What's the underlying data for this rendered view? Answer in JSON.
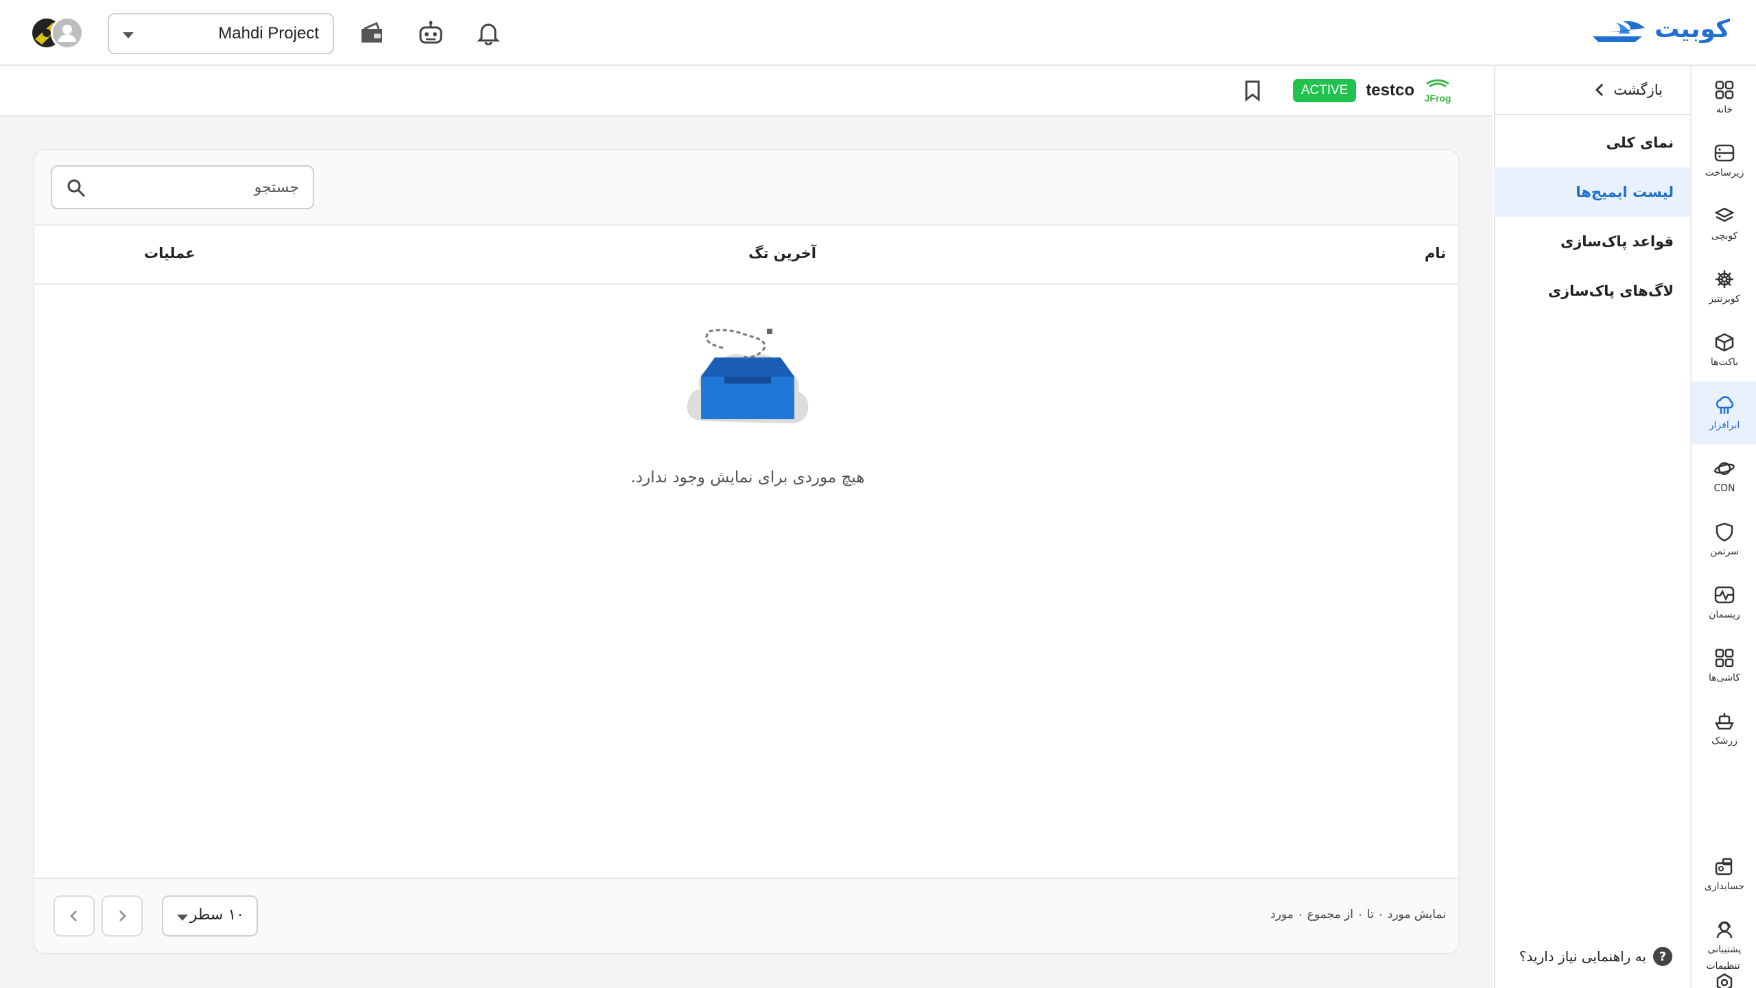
{
  "header": {
    "logo_text": "کوبیت",
    "project_select": "Mahdi Project",
    "icons": [
      "wallet-icon",
      "robot-icon",
      "bell-icon"
    ]
  },
  "rail": {
    "items": [
      {
        "label": "خانه",
        "icon": "grid-icon"
      },
      {
        "label": "زیرساخت",
        "icon": "server-icon"
      },
      {
        "label": "کوبچی",
        "icon": "layers-icon"
      },
      {
        "label": "کوبرنتیز",
        "icon": "helm-icon"
      },
      {
        "label": "باکت‌ها",
        "icon": "box-icon"
      },
      {
        "label": "ابرافزار",
        "icon": "cloud-icon",
        "active": true
      },
      {
        "label": "CDN",
        "icon": "planet-icon"
      },
      {
        "label": "سرتمن",
        "icon": "shield-icon"
      },
      {
        "label": "ریسمان",
        "icon": "pulse-icon"
      },
      {
        "label": "کاشی‌ها",
        "icon": "tiles-icon"
      },
      {
        "label": "زرشک",
        "icon": "ship-icon"
      },
      {
        "label": "حسابداری",
        "icon": "accounting-icon"
      },
      {
        "label": "پشتیبانی",
        "icon": "support-icon"
      },
      {
        "label": "تنظیمات",
        "icon": "settings-icon"
      }
    ]
  },
  "sidenav": {
    "back": "بازگشت",
    "items": [
      "نمای کلی",
      "لیست ایمیج‌ها",
      "قواعد پاک‌سازی",
      "لاگ‌های پاک‌سازی"
    ],
    "active_index": 1,
    "help": "به راهنمایی نیاز دارید؟",
    "help_mark": "?"
  },
  "subheader": {
    "repo_name": "testco",
    "status": "ACTIVE",
    "logo_label": "JFrog",
    "status_color": "#1ec24c"
  },
  "table": {
    "search_placeholder": "جستجو",
    "columns": [
      "نام",
      "آخرین تگ",
      "عملیات"
    ],
    "empty_message": "هیچ موردی برای نمایش وجود ندارد."
  },
  "footer": {
    "rows_per_page": "۱۰ سطر",
    "info": "نمایش مورد ۰ تا ۰ از مجموع ۰ مورد"
  },
  "colors": {
    "accent": "#1f6fd1",
    "active_bg": "#e9f1fc"
  }
}
